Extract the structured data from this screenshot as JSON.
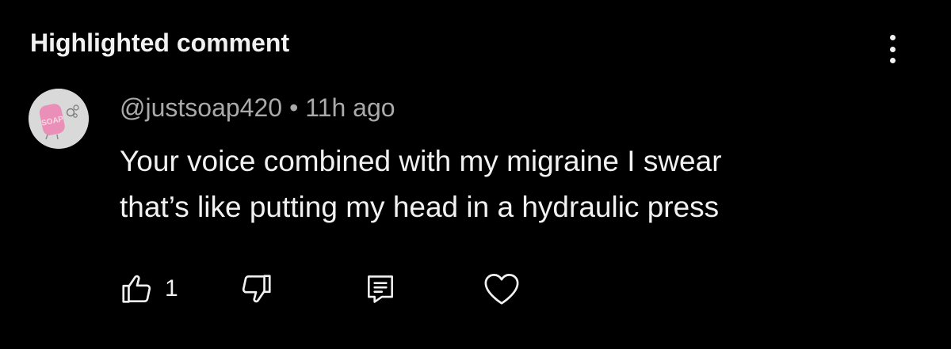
{
  "header": {
    "title": "Highlighted comment"
  },
  "comment": {
    "author": "@justsoap420",
    "separator": "•",
    "time": "11h ago",
    "text_lines": [
      "Your voice combined with my migraine I swear",
      "that’s like putting my head in a hydraulic press"
    ],
    "like_count": "1"
  },
  "icons": {
    "more": "more-vert-icon",
    "like": "thumb-up-icon",
    "dislike": "thumb-down-icon",
    "reply": "reply-comment-icon",
    "heart": "heart-icon"
  },
  "colors": {
    "background": "#000000",
    "primary_text": "#f1f1f1",
    "secondary_text": "#aaaaaa",
    "avatar_bg": "#d9d9d9",
    "avatar_accent": "#e98fb8"
  }
}
